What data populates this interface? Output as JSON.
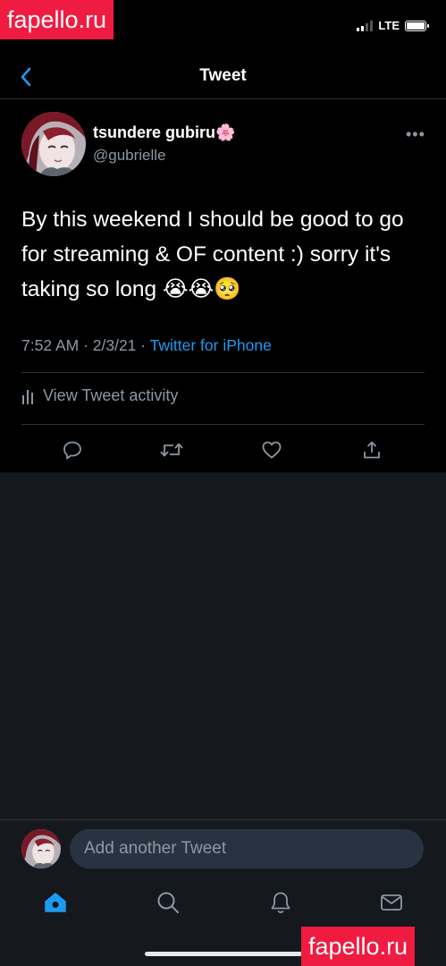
{
  "status_bar": {
    "network": "LTE"
  },
  "nav": {
    "title": "Tweet"
  },
  "tweet": {
    "author_name": "tsundere gubiru🌸",
    "author_handle": "@gubrielle",
    "text": "By this weekend I should be good to go for streaming & OF content :) sorry it's taking so long 😭😭🥺",
    "time": "7:52 AM · 2/3/21 · ",
    "source": "Twitter for iPhone",
    "activity_label": "View Tweet activity"
  },
  "composer": {
    "placeholder": "Add another Tweet"
  },
  "watermark": {
    "text": "fapello.ru"
  },
  "colors": {
    "accent": "#1d9bf0",
    "muted": "#8b98a5",
    "background": "#000000",
    "body": "#15181c",
    "watermark": "#f01b41"
  },
  "icons": [
    "back-chevron-icon",
    "more-icon",
    "reply-icon",
    "retweet-icon",
    "like-icon",
    "share-icon",
    "analytics-icon",
    "home-icon",
    "search-icon",
    "notifications-icon",
    "messages-icon"
  ]
}
